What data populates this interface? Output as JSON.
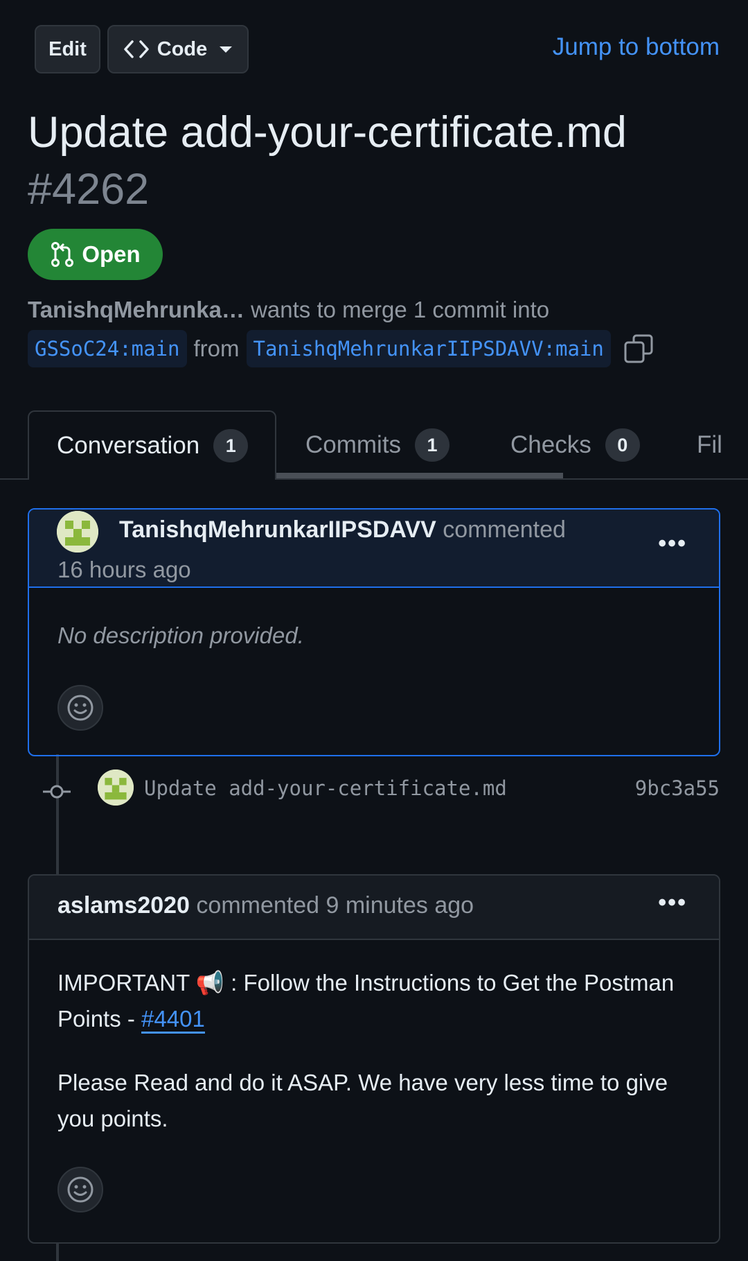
{
  "toolbar": {
    "edit_label": "Edit",
    "code_label": "Code",
    "jump_label": "Jump to bottom"
  },
  "pr": {
    "title": "Update add-your-certificate.md",
    "number": "#4262",
    "status": "Open",
    "author_short": "TanishqMehrunka…",
    "merge_text": "wants to merge 1 commit into",
    "base_branch": "GSSoC24:main",
    "from_text": "from",
    "head_branch": "TanishqMehrunkarIIPSDAVV:main"
  },
  "tabs": [
    {
      "label": "Conversation",
      "count": "1"
    },
    {
      "label": "Commits",
      "count": "1"
    },
    {
      "label": "Checks",
      "count": "0"
    },
    {
      "label": "Fil"
    }
  ],
  "comment1": {
    "author": "TanishqMehrunkarIIPSDAVV",
    "action": "commented",
    "time": "16 hours ago",
    "body": "No description provided."
  },
  "commit": {
    "message": "Update add-your-certificate.md",
    "sha": "9bc3a55"
  },
  "comment2": {
    "author": "aslams2020",
    "meta": "commented 9 minutes ago",
    "line1_prefix": "IMPORTANT 📢 : Follow the Instructions to Get the Postman Points - ",
    "link": "#4401",
    "line2": "Please Read and do it ASAP. We have very less time to give you points."
  },
  "colors": {
    "background": "#0d1117",
    "accent_blue": "#4493f8",
    "open_green": "#238636",
    "muted_text": "#9198a1"
  }
}
